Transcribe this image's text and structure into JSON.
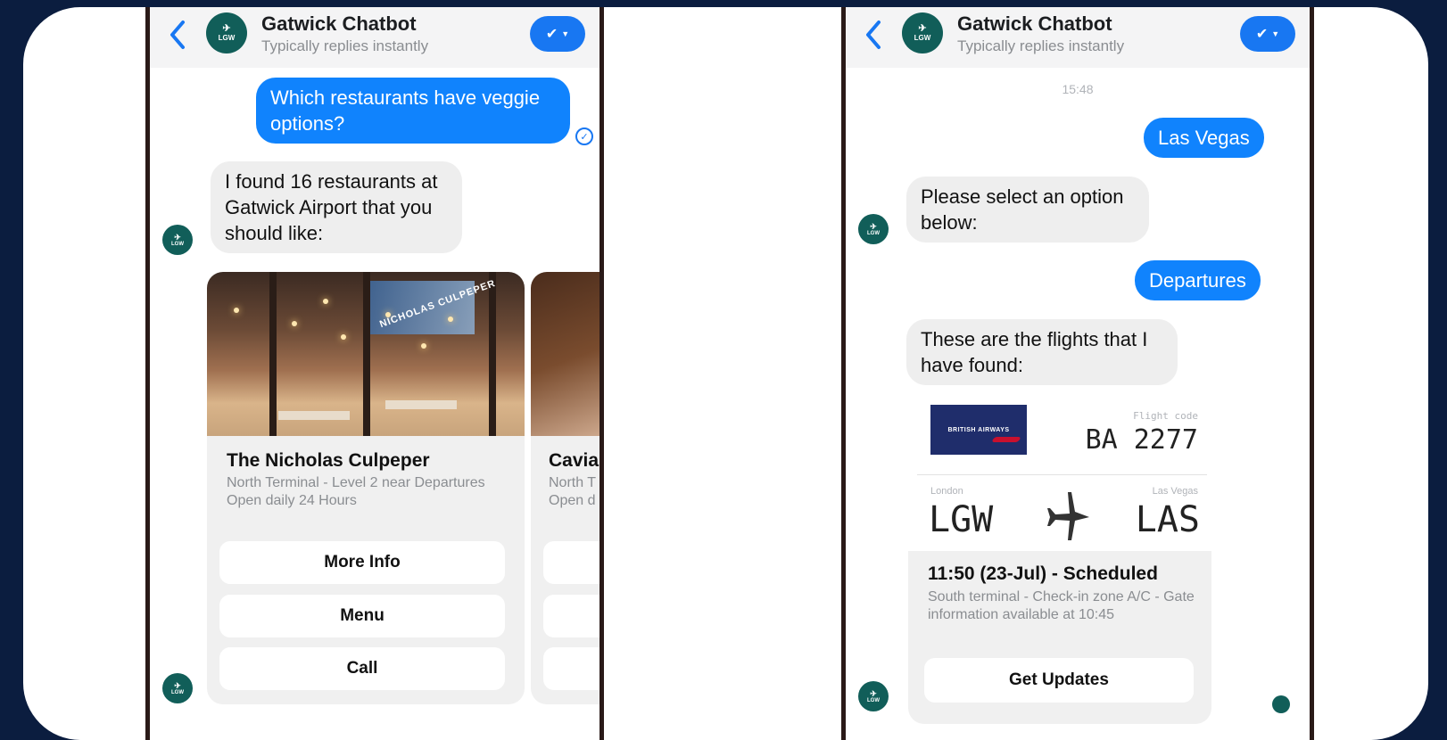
{
  "left_chat": {
    "header": {
      "title": "Gatwick Chatbot",
      "status": "Typically replies instantly",
      "avatar_text": "LGW"
    },
    "messages": {
      "user_question": "Which restaurants have veggie options?",
      "bot_reply": "I found 16 restaurants at Gatwick Airport that you should like:"
    },
    "restaurant_card": {
      "name": "The Nicholas Culpeper",
      "location": "North Terminal - Level 2 near Departures",
      "hours": "Open daily 24 Hours",
      "photo_sign": "NICHOLAS CULPEPER",
      "buttons": [
        "More Info",
        "Menu",
        "Call"
      ]
    },
    "peek_card": {
      "name": "Cavia",
      "location": "North T",
      "hours": "Open d"
    }
  },
  "right_chat": {
    "header": {
      "title": "Gatwick Chatbot",
      "status": "Typically replies instantly",
      "avatar_text": "LGW"
    },
    "timestamp": "15:48",
    "messages": {
      "user_destination": "Las Vegas",
      "bot_prompt": "Please select an option below:",
      "user_choice": "Departures",
      "bot_result": "These are the flights that I have found:"
    },
    "flight": {
      "airline_logo_text": "BRITISH AIRWAYS",
      "code_label": "Flight code",
      "code": "BA 2277",
      "from_city": "London",
      "from_code": "LGW",
      "to_city": "Las Vegas",
      "to_code": "LAS",
      "time_status": "11:50 (23-Jul) - Scheduled",
      "details": "South terminal - Check-in zone A/C - Gate information available at 10:45",
      "button": "Get Updates"
    }
  },
  "colors": {
    "background": "#0b1d3f",
    "messenger_blue": "#1877f2",
    "avatar": "#115e59"
  }
}
